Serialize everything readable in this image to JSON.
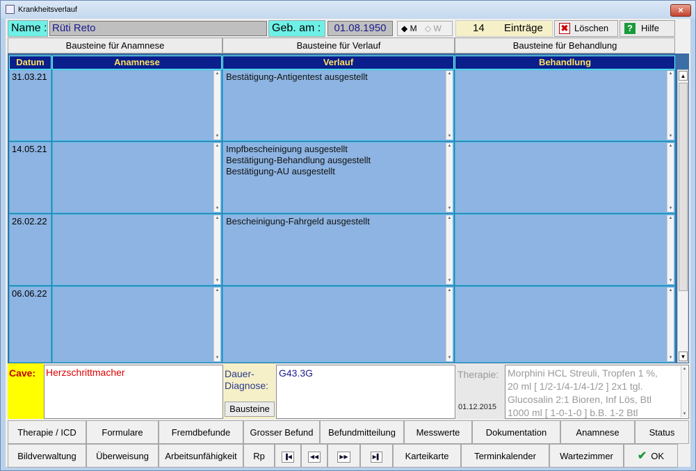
{
  "window": {
    "title": "Krankheitsverlauf",
    "close": "×"
  },
  "patient": {
    "name_label": "Name :",
    "name_value": "Rüti Reto",
    "dob_label": "Geb. am :",
    "dob_value": "01.08.1950",
    "gender_m": "M",
    "gender_w": "W",
    "entries_count": "14",
    "entries_label": "Einträge"
  },
  "toolbar": {
    "delete": "Löschen",
    "help": "Hilfe"
  },
  "bausteine": {
    "anamnese": "Bausteine für Anamnese",
    "verlauf": "Bausteine für Verlauf",
    "behandlung": "Bausteine für Behandlung"
  },
  "table": {
    "headers": {
      "datum": "Datum",
      "anamnese": "Anamnese",
      "verlauf": "Verlauf",
      "behandlung": "Behandlung"
    },
    "rows": [
      {
        "date": "31.03.21",
        "anamnese": "",
        "verlauf": [
          "Bestätigung-Antigentest ausgestellt"
        ],
        "behandlung": ""
      },
      {
        "date": "14.05.21",
        "anamnese": "",
        "verlauf": [
          "Impfbescheinigung ausgestellt",
          "Bestätigung-Behandlung ausgestellt",
          "Bestätigung-AU ausgestellt"
        ],
        "behandlung": ""
      },
      {
        "date": "26.02.22",
        "anamnese": "",
        "verlauf": [
          "Bescheinigung-Fahrgeld ausgestellt"
        ],
        "behandlung": ""
      },
      {
        "date": "06.06.22",
        "anamnese": "",
        "verlauf": [],
        "behandlung": ""
      }
    ]
  },
  "cave": {
    "label": "Cave:",
    "value": "Herzschrittmacher"
  },
  "dauer": {
    "label_line1": "Dauer-",
    "label_line2": "Diagnose:",
    "button": "Bausteine",
    "value": "G43.3G"
  },
  "therapie": {
    "label": "Therapie:",
    "date": "01.12.2015",
    "lines": [
      "Morphini HCL Streuli, Tropfen 1 %,",
      "20 ml [ 1/2-1/4-1/4-1/2 ] 2x1 tgl.",
      "Glucosalin 2:1 Bioren, Inf Lös, Btl",
      "1000 ml [ 1-0-1-0 ] b.B. 1-2 Btl"
    ]
  },
  "buttons": {
    "row1": [
      "Therapie / ICD",
      "Formulare",
      "Fremdbefunde",
      "Grosser Befund",
      "Befundmitteilung",
      "Messwerte",
      "Dokumentation",
      "Anamnese",
      "Status"
    ],
    "row2": [
      "Bildverwaltung",
      "Überweisung",
      "Arbeitsunfähigkeit",
      "Rp",
      "",
      "",
      "",
      "",
      "Karteikarte",
      "Terminkalender",
      "Wartezimmer",
      "OK"
    ]
  },
  "colors": {
    "header_bg": "#0a1e8c",
    "header_text": "#ffe060",
    "cell_bg": "#8db4e2",
    "teal": "#6ff0e6",
    "cave_bg": "#ffff00"
  }
}
